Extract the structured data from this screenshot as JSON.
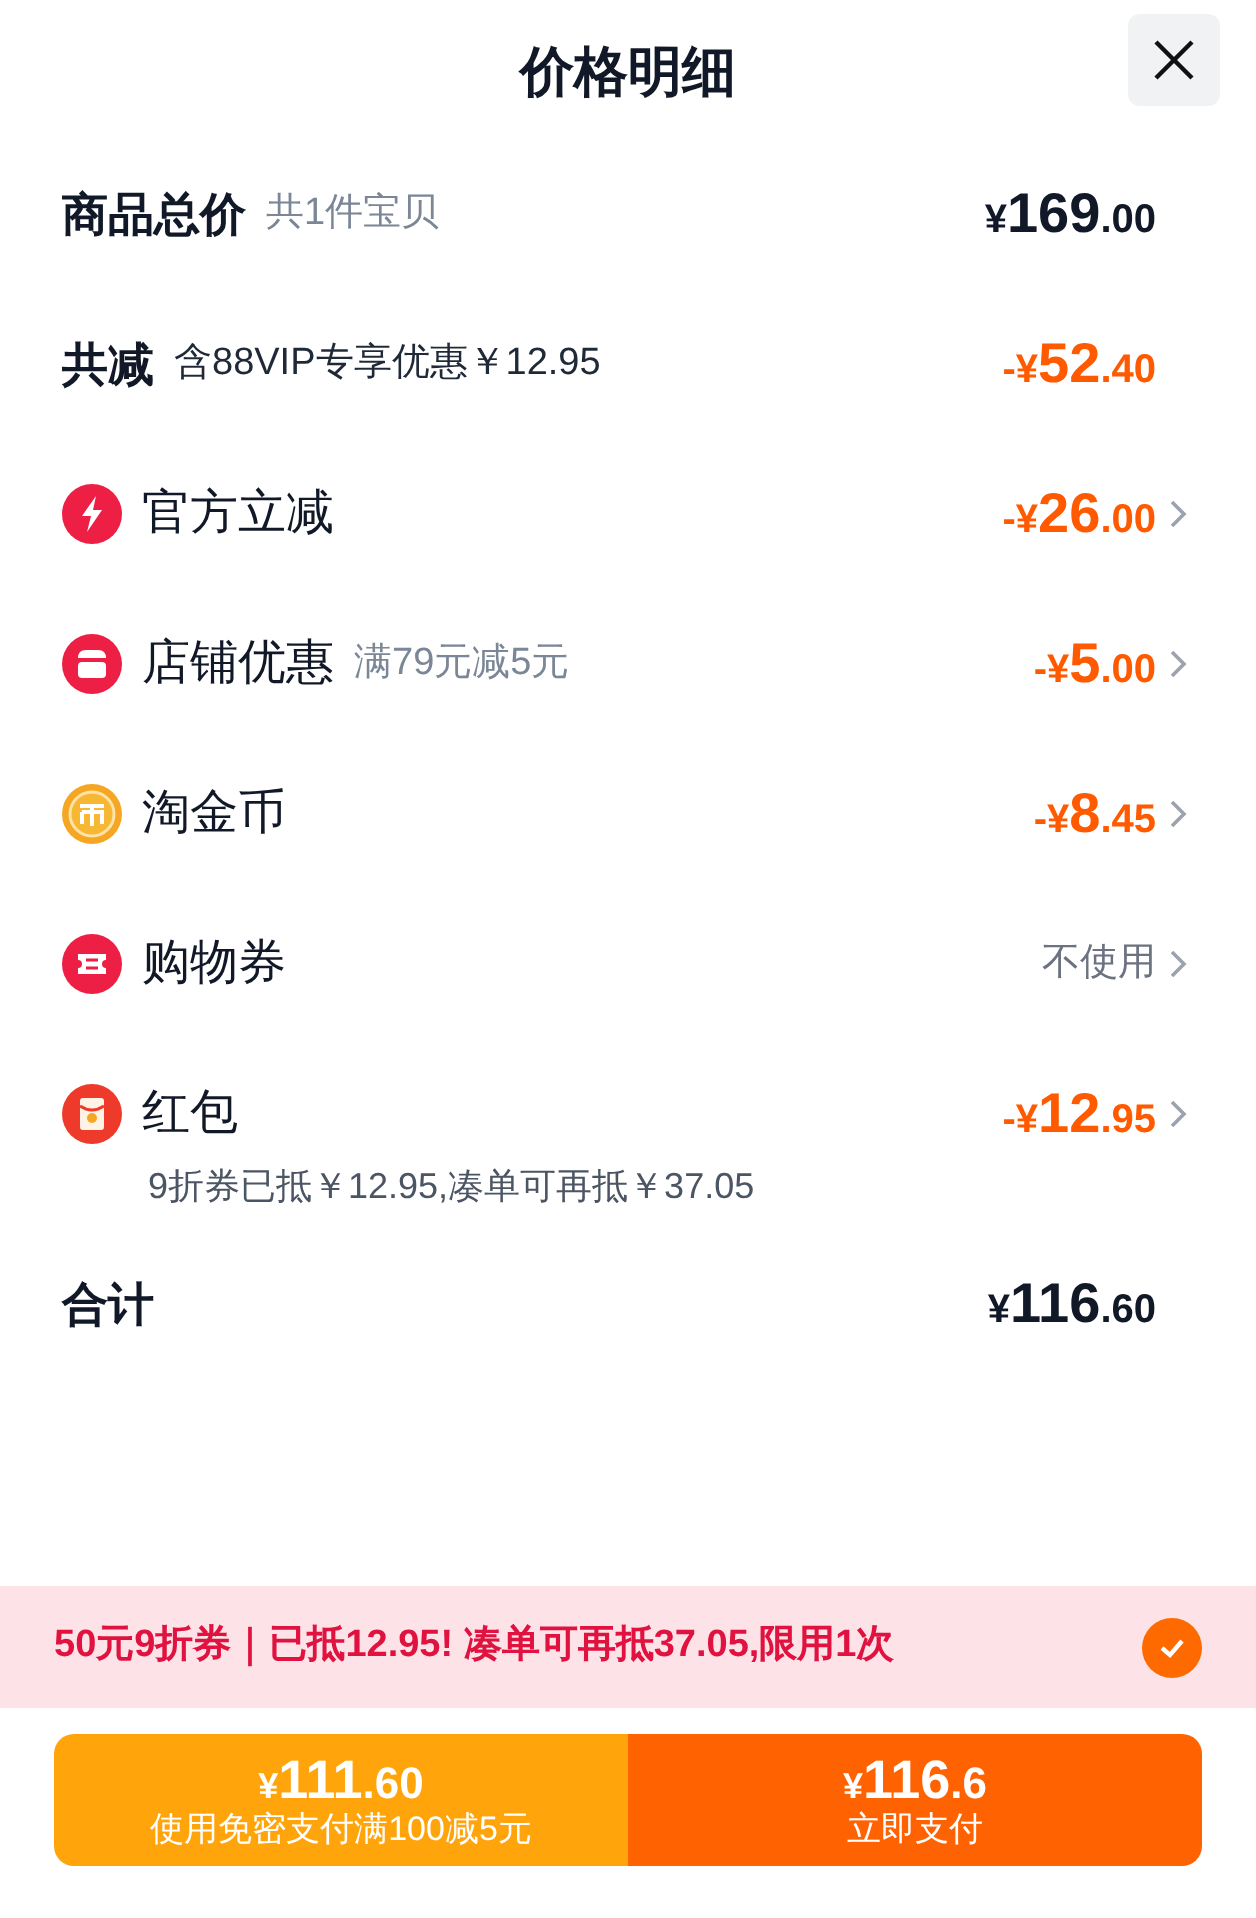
{
  "title": "价格明细",
  "rows": [
    {
      "kind": "total",
      "label": "商品总价",
      "note": "共1件宝贝",
      "price": {
        "sign": "¥",
        "whole": "169",
        "fraction": ".00"
      }
    },
    {
      "kind": "deduction",
      "label": "共减",
      "note": "含88VIP专享优惠￥12.95",
      "price": {
        "sign": "-¥",
        "whole": "52",
        "fraction": ".40"
      }
    },
    {
      "kind": "item",
      "label": "官方立减",
      "price": {
        "sign": "-¥",
        "whole": "26",
        "fraction": ".00"
      }
    },
    {
      "kind": "item",
      "label": "店铺优惠",
      "note": "满79元减5元",
      "price": {
        "sign": "-¥",
        "whole": "5",
        "fraction": ".00"
      }
    },
    {
      "kind": "item",
      "label": "淘金币",
      "price": {
        "sign": "-¥",
        "whole": "8",
        "fraction": ".45"
      }
    },
    {
      "kind": "item",
      "label": "购物券",
      "value": "不使用"
    },
    {
      "kind": "item",
      "label": "红包",
      "price": {
        "sign": "-¥",
        "whole": "12",
        "fraction": ".95"
      },
      "detail": "9折券已抵￥12.95,凑单可再抵￥37.05"
    },
    {
      "kind": "total",
      "label": "合计",
      "price": {
        "sign": "¥",
        "whole": "116",
        "fraction": ".60"
      }
    }
  ],
  "banner": {
    "text": "50元9折券｜已抵12.95! 凑单可再抵37.05,限用1次",
    "checked": true
  },
  "buttons": [
    {
      "kind": "secondary",
      "price": {
        "sign": "¥",
        "whole": "111",
        "fraction": ".60"
      },
      "label": "使用免密支付满100减5元"
    },
    {
      "kind": "primary",
      "price": {
        "sign": "¥",
        "whole": "116",
        "fraction": ".6"
      },
      "label": "立即支付"
    }
  ]
}
